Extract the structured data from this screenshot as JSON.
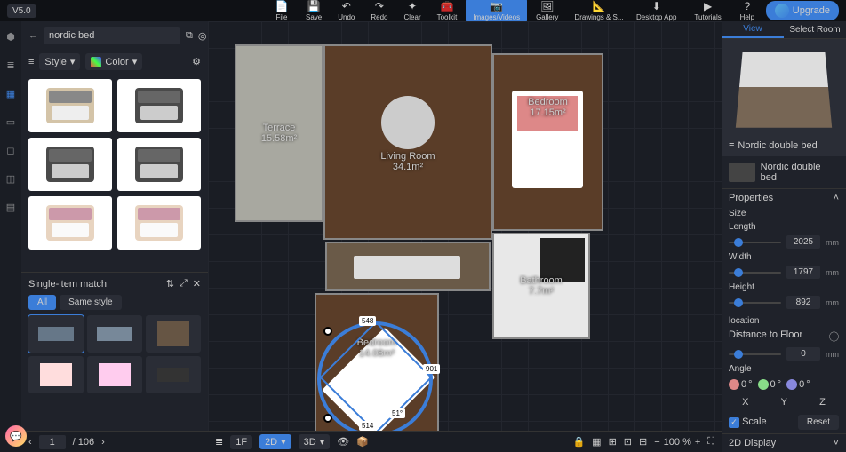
{
  "version": "V5.0",
  "toolbar": [
    {
      "id": "file",
      "label": "File",
      "icon": "📄"
    },
    {
      "id": "save",
      "label": "Save",
      "icon": "💾"
    },
    {
      "id": "undo",
      "label": "Undo",
      "icon": "↶"
    },
    {
      "id": "redo",
      "label": "Redo",
      "icon": "↷"
    },
    {
      "id": "clear",
      "label": "Clear",
      "icon": "✦"
    },
    {
      "id": "toolkit",
      "label": "Toolkit",
      "icon": "🧰"
    },
    {
      "id": "images",
      "label": "Images/Videos",
      "icon": "📷",
      "active": true
    },
    {
      "id": "gallery",
      "label": "Gallery",
      "icon": "🖼"
    },
    {
      "id": "drawings",
      "label": "Drawings & S...",
      "icon": "📐"
    }
  ],
  "topbar_right": [
    {
      "id": "desktop",
      "label": "Desktop App",
      "icon": "⬇"
    },
    {
      "id": "tutorials",
      "label": "Tutorials",
      "icon": "▶"
    },
    {
      "id": "help",
      "label": "Help",
      "icon": "?"
    }
  ],
  "upgrade_label": "Upgrade",
  "search": {
    "value": "nordic bed",
    "placeholder": "Search"
  },
  "filters": {
    "style_label": "Style",
    "color_label": "Color"
  },
  "match": {
    "title": "Single-item match",
    "tabs": [
      {
        "id": "all",
        "label": "All",
        "active": true
      },
      {
        "id": "same",
        "label": "Same style"
      }
    ]
  },
  "pager": {
    "current": "1",
    "total": "106"
  },
  "rooms": {
    "terrace": {
      "name": "Terrace",
      "area": "15.58m²"
    },
    "living": {
      "name": "Living Room",
      "area": "34.1m²"
    },
    "bed1": {
      "name": "Bedroom",
      "area": "17.15m²"
    },
    "bath": {
      "name": "Bathroom",
      "area": "7.7m²"
    },
    "bed2": {
      "name": "Bedroom",
      "area": "14.08m²"
    }
  },
  "dims": {
    "top": "548",
    "right": "901",
    "bottom": "514",
    "angle": "51°"
  },
  "bottom": {
    "floor": "1F",
    "mode2d": "2D",
    "mode3d": "3D",
    "zoom": "100",
    "zoom_unit": "%"
  },
  "right": {
    "tab_view": "View",
    "tab_select": "Select Room",
    "object_name": "Nordic double bed",
    "object_label": "Nordic double bed",
    "props_title": "Properties",
    "size_title": "Size",
    "length": {
      "label": "Length",
      "value": "2025",
      "unit": "mm"
    },
    "width": {
      "label": "Width",
      "value": "1797",
      "unit": "mm"
    },
    "height": {
      "label": "Height",
      "value": "892",
      "unit": "mm"
    },
    "location_title": "location",
    "dist_floor": {
      "label": "Distance to Floor",
      "value": "0",
      "unit": "mm"
    },
    "angle_title": "Angle",
    "angles": {
      "x": "0",
      "y": "0",
      "z": "0",
      "deg": "°",
      "xl": "X",
      "yl": "Y",
      "zl": "Z"
    },
    "scale_label": "Scale",
    "reset_label": "Reset",
    "display2d": "2D Display"
  }
}
